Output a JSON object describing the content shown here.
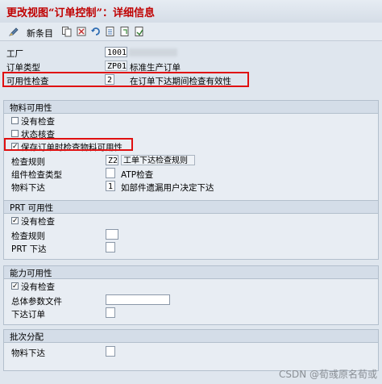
{
  "window": {
    "title": "更改视图“订单控制”：详细信息"
  },
  "toolbar": {
    "new_entries_label": "新条目"
  },
  "header_fields": {
    "plant": {
      "label": "工厂",
      "value": "1001"
    },
    "order_type": {
      "label": "订单类型",
      "value": "ZP01",
      "text": "标准生产订单"
    },
    "availability_check": {
      "label": "可用性检查",
      "value": "2",
      "text": "在订单下达期间检查有效性"
    }
  },
  "material_group": {
    "title": "物料可用性",
    "no_check": {
      "label": "没有检查",
      "checked": false
    },
    "status_check": {
      "label": "状态核查",
      "checked": false
    },
    "save_check": {
      "label": "保存订单时检查物料可用性",
      "checked": true
    },
    "check_rule": {
      "label": "检查规则",
      "value": "Z2",
      "text": "工单下达检查规则"
    },
    "component_check_type": {
      "label": "组件检查类型",
      "value": "",
      "text": "ATP检查"
    },
    "material_release": {
      "label": "物料下达",
      "value": "1",
      "text": "如部件遗漏用户决定下达"
    }
  },
  "prt_group": {
    "title": "PRT 可用性",
    "no_check": {
      "label": "没有检查",
      "checked": true
    },
    "check_rule": {
      "label": "检查规则",
      "value": ""
    },
    "prt_release": {
      "label": "PRT 下达",
      "value": ""
    }
  },
  "capacity_group": {
    "title": "能力可用性",
    "no_check": {
      "label": "没有检查",
      "checked": true
    },
    "overall_profile": {
      "label": "总体参数文件",
      "value": ""
    },
    "release_order": {
      "label": "下达订单",
      "value": ""
    }
  },
  "batch_group": {
    "title": "批次分配",
    "material_release": {
      "label": "物料下达",
      "value": ""
    }
  },
  "watermark": "CSDN @荀彧原名荀或",
  "colors": {
    "highlight": "#e01010",
    "title": "#c00000",
    "background": "#dfe6ee"
  },
  "icons": [
    "pen-icon",
    "copy-icon",
    "delete-icon",
    "undo-icon",
    "select-all-icon",
    "deselect-icon",
    "transport-icon"
  ]
}
